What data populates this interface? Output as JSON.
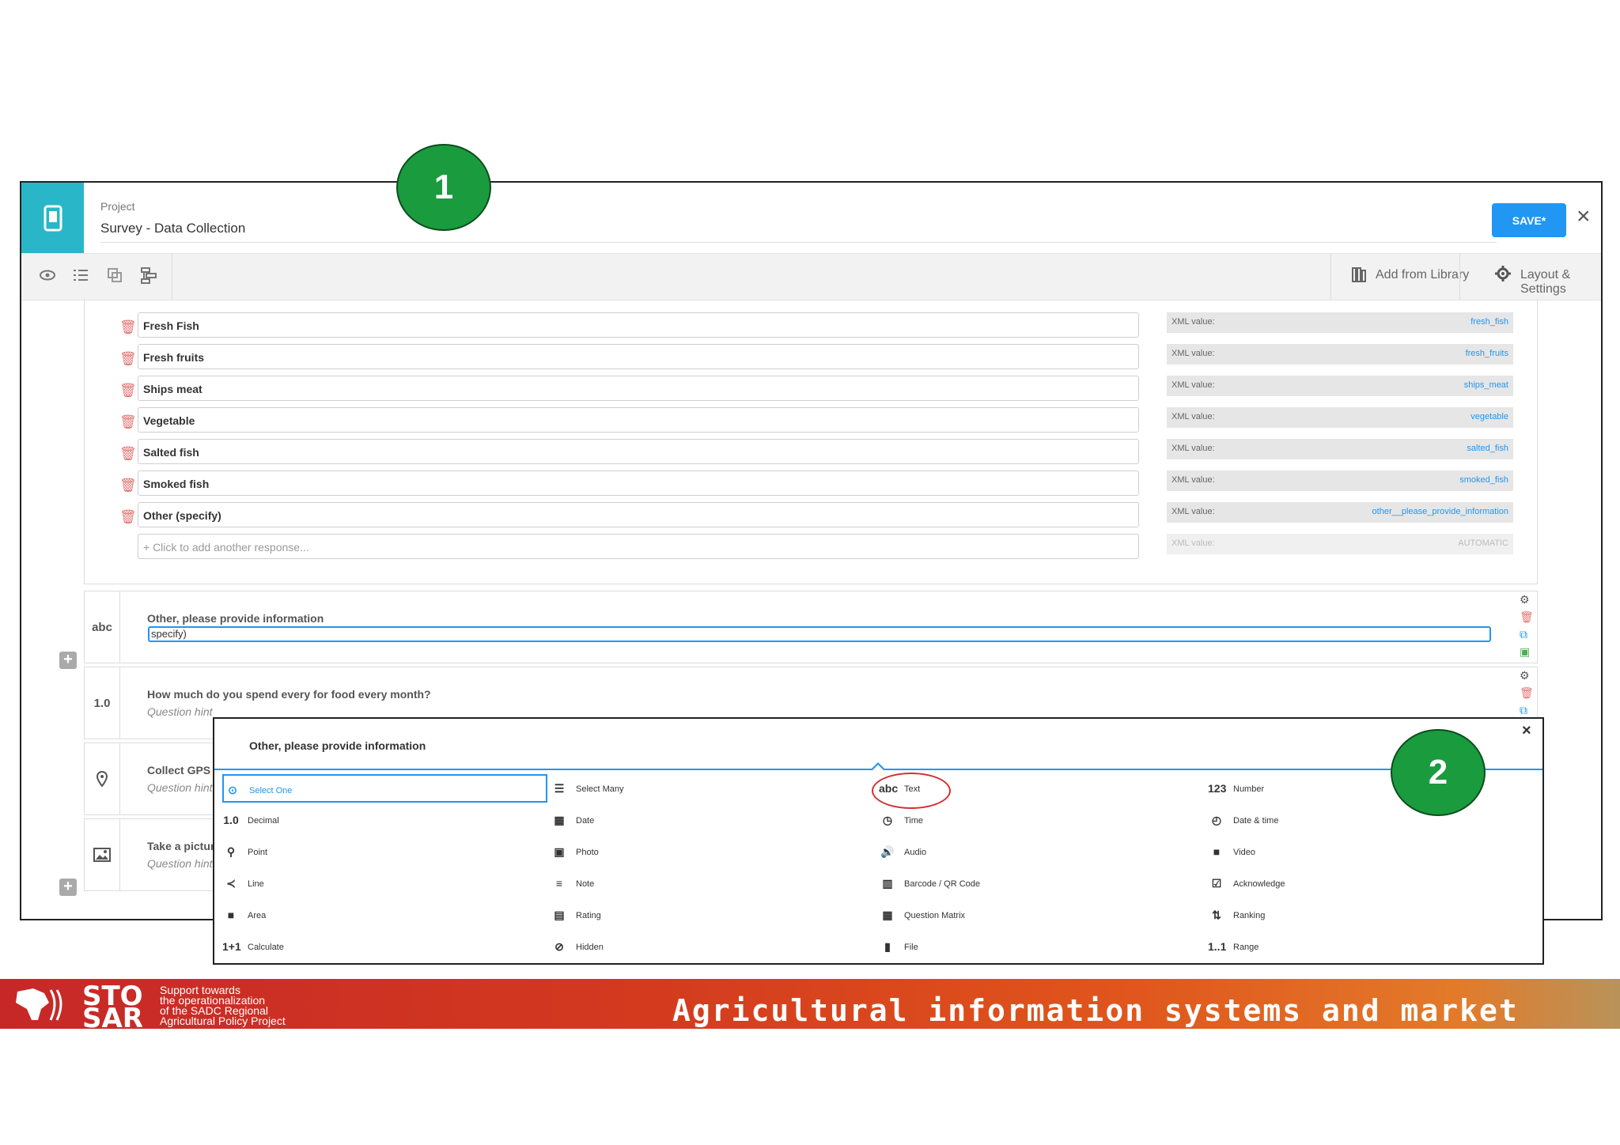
{
  "header": {
    "project_label": "Project",
    "project_name": "Survey - Data Collection",
    "save_label": "SAVE*",
    "close_label": "×"
  },
  "toolbar": {
    "add_from_library": "Add from Library",
    "layout_settings": "Layout & Settings"
  },
  "choices": [
    {
      "label": "Fresh Fish",
      "xml_label": "XML value:",
      "xml_value": "fresh_fish"
    },
    {
      "label": "Fresh fruits",
      "xml_label": "XML value:",
      "xml_value": "fresh_fruits"
    },
    {
      "label": "Ships meat",
      "xml_label": "XML value:",
      "xml_value": "ships_meat"
    },
    {
      "label": "Vegetable",
      "xml_label": "XML value:",
      "xml_value": "vegetable"
    },
    {
      "label": "Salted fish",
      "xml_label": "XML value:",
      "xml_value": "salted_fish"
    },
    {
      "label": "Smoked fish",
      "xml_label": "XML value:",
      "xml_value": "smoked_fish"
    },
    {
      "label": "Other (specify)",
      "xml_label": "XML value:",
      "xml_value": "other__please_provide_information"
    }
  ],
  "add_response": {
    "placeholder": "+ Click to add another response...",
    "xml_label": "XML value:",
    "xml_value": "AUTOMATIC"
  },
  "questions": [
    {
      "type": "abc",
      "title": "Other, please provide information",
      "value": "specify)"
    },
    {
      "type": "1.0",
      "title": "How much do you spend every for food every month?",
      "hint": "Question hint"
    },
    {
      "type": "location",
      "title": "Collect GPS o",
      "hint": "Question hint"
    },
    {
      "type": "image",
      "title": "Take a picture",
      "hint": "Question hint"
    }
  ],
  "callouts": [
    "1",
    "2"
  ],
  "popup": {
    "title": "Other, please provide information",
    "close": "×",
    "options": [
      {
        "icon": "radio-icon",
        "glyph": "⊙",
        "label": "Select One"
      },
      {
        "icon": "list-icon",
        "glyph": "☰",
        "label": "Select Many"
      },
      {
        "icon": "text-icon",
        "glyph": "abc",
        "label": "Text"
      },
      {
        "icon": "number-icon",
        "glyph": "123",
        "label": "Number"
      },
      {
        "icon": "decimal-icon",
        "glyph": "1.0",
        "label": "Decimal"
      },
      {
        "icon": "calendar-icon",
        "glyph": "▦",
        "label": "Date"
      },
      {
        "icon": "clock-icon",
        "glyph": "◷",
        "label": "Time"
      },
      {
        "icon": "datetime-icon",
        "glyph": "◴",
        "label": "Date & time"
      },
      {
        "icon": "pin-icon",
        "glyph": "⚲",
        "label": "Point"
      },
      {
        "icon": "photo-icon",
        "glyph": "▣",
        "label": "Photo"
      },
      {
        "icon": "audio-icon",
        "glyph": "🔊",
        "label": "Audio"
      },
      {
        "icon": "video-icon",
        "glyph": "■",
        "label": "Video"
      },
      {
        "icon": "share-icon",
        "glyph": "≺",
        "label": "Line"
      },
      {
        "icon": "note-icon",
        "glyph": "≡",
        "label": "Note"
      },
      {
        "icon": "barcode-icon",
        "glyph": "▥",
        "label": "Barcode / QR Code"
      },
      {
        "icon": "check-icon",
        "glyph": "☑",
        "label": "Acknowledge"
      },
      {
        "icon": "square-icon",
        "glyph": "■",
        "label": "Area"
      },
      {
        "icon": "rating-icon",
        "glyph": "▤",
        "label": "Rating"
      },
      {
        "icon": "grid-icon",
        "glyph": "▦",
        "label": "Question Matrix"
      },
      {
        "icon": "sort-icon",
        "glyph": "⇅",
        "label": "Ranking"
      },
      {
        "icon": "calc-icon",
        "glyph": "1+1",
        "label": "Calculate"
      },
      {
        "icon": "hidden-icon",
        "glyph": "⊘",
        "label": "Hidden"
      },
      {
        "icon": "file-icon",
        "glyph": "▮",
        "label": "File"
      },
      {
        "icon": "range-icon",
        "glyph": "1..1",
        "label": "Range"
      }
    ]
  },
  "banner": {
    "logo_text_1": "STO",
    "logo_text_2": "SAR",
    "sub_1": "Support towards",
    "sub_2": "the operationalization",
    "sub_3": "of the SADC Regional",
    "sub_4": "Agricultural Policy Project",
    "tagline": "Agricultural information systems and market access"
  },
  "colors": {
    "accent": "#2196f3",
    "logo_bg": "#29b6c8",
    "callout": "#1a9b3e",
    "delete": "#e57373"
  }
}
